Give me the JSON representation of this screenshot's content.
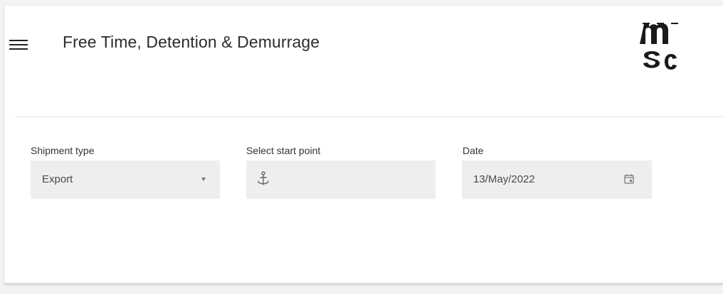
{
  "header": {
    "title": "Free Time, Detention & Demurrage",
    "menu_icon": "hamburger-menu-icon",
    "logo_text": "msc",
    "logo_icon": "msc-logo"
  },
  "form": {
    "shipment_type": {
      "label": "Shipment type",
      "value": "Export",
      "icon": "caret-down-icon"
    },
    "start_point": {
      "label": "Select start point",
      "value": "",
      "icon": "anchor-icon"
    },
    "date": {
      "label": "Date",
      "value": "13/May/2022",
      "icon": "calendar-icon"
    }
  },
  "colors": {
    "field_background": "#eeeeee",
    "text_primary": "#2b2b2b",
    "page_background": "#ffffff"
  }
}
